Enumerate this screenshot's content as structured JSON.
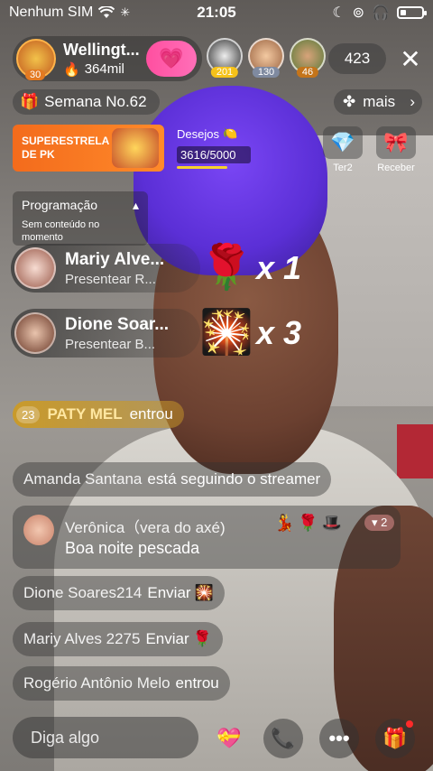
{
  "status_bar": {
    "carrier": "Nenhum SIM",
    "time": "21:05"
  },
  "host": {
    "name": "Wellingt...",
    "likes": "364mil",
    "level": "30"
  },
  "viewer_avatars": [
    {
      "badge": "201",
      "color": "#f6c21a"
    },
    {
      "badge": "130",
      "color": "#7f8aa0"
    },
    {
      "badge": "46",
      "color": "#c4741a"
    }
  ],
  "viewer_count": "423",
  "week": {
    "label": "Semana No.62"
  },
  "more": {
    "label": "mais"
  },
  "pk_banner": {
    "text": "SUPERESTRELA DE PK"
  },
  "wishes": {
    "label": "Desejos",
    "progress": "3616/5000",
    "fraction": 0.72
  },
  "side_buttons": [
    {
      "label": "Ter2",
      "icon": "gem-icon"
    },
    {
      "label": "Receber",
      "icon": "lightstick-icon"
    }
  ],
  "schedule": {
    "title": "Programação",
    "subtitle": "Sem conteúdo no momento"
  },
  "gifts": [
    {
      "name": "Mariy Alve...",
      "msg": "Presentear R...",
      "multiplier": "x 1",
      "icon": "rose-icon"
    },
    {
      "name": "Dione Soar...",
      "msg": "Presentear B...",
      "multiplier": "x 3",
      "icon": "lightstick-icon"
    }
  ],
  "entry": {
    "level": "23",
    "name": "PATY MEL",
    "action": "entrou"
  },
  "chat": [
    {
      "who": "Amanda Santana",
      "what": "está seguindo o streamer"
    },
    {
      "who": "Dione Soares214",
      "what": "Enviar"
    },
    {
      "who": "Mariy Alves 2275",
      "what": "Enviar"
    },
    {
      "who": "Rogério Antônio Melo",
      "what": "entrou"
    }
  ],
  "chat_big": {
    "name": "Verônica（vera do axé)",
    "message": "Boa noite pescada",
    "badge_count": "2"
  },
  "input": {
    "placeholder": "Diga algo"
  },
  "colors": {
    "accent": "#ff4fa0",
    "gold": "#f6d22c",
    "pk": "#f36b1c"
  }
}
